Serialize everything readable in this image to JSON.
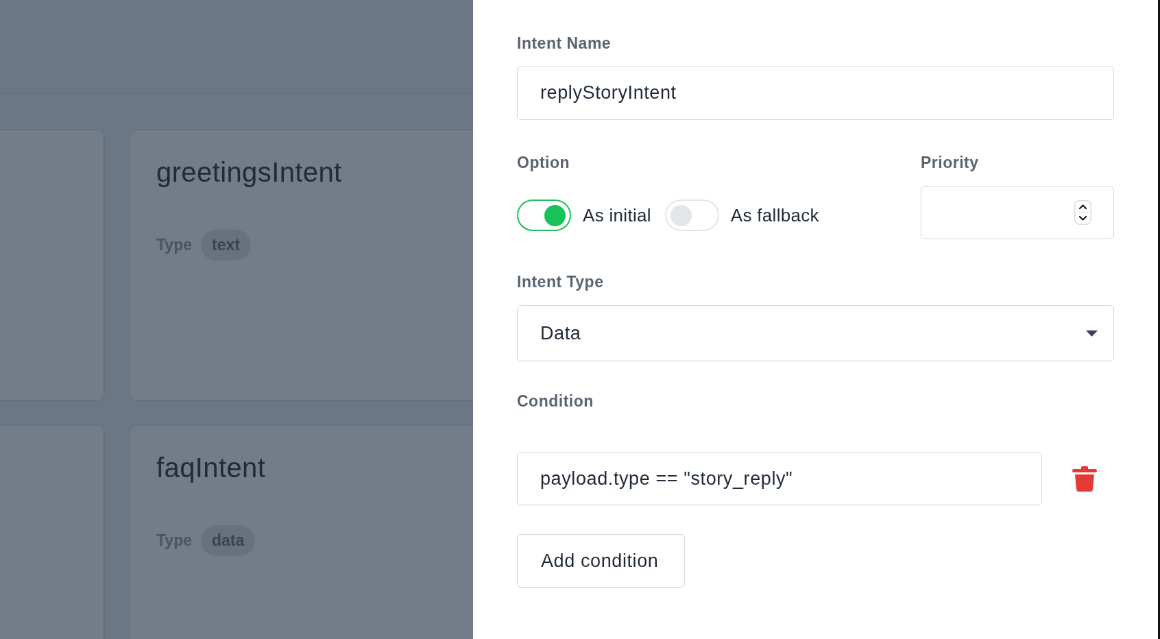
{
  "backdrop": {
    "cards": [
      {
        "title": "greetingsIntent",
        "type_label": "Type",
        "type": "text"
      },
      {
        "title": "faqIntent",
        "type_label": "Type",
        "type": "data"
      }
    ]
  },
  "panel": {
    "intent_name": {
      "label": "Intent Name",
      "value": "replyStoryIntent"
    },
    "option": {
      "label": "Option",
      "toggles": [
        {
          "label": "As initial",
          "on": true
        },
        {
          "label": "As fallback",
          "on": false
        }
      ]
    },
    "priority": {
      "label": "Priority"
    },
    "intent_type": {
      "label": "Intent Type",
      "value": "Data"
    },
    "condition": {
      "label": "Condition",
      "rows": [
        {
          "value": "payload.type == \"story_reply\""
        }
      ]
    },
    "add_button": {
      "label": "Add condition"
    }
  }
}
